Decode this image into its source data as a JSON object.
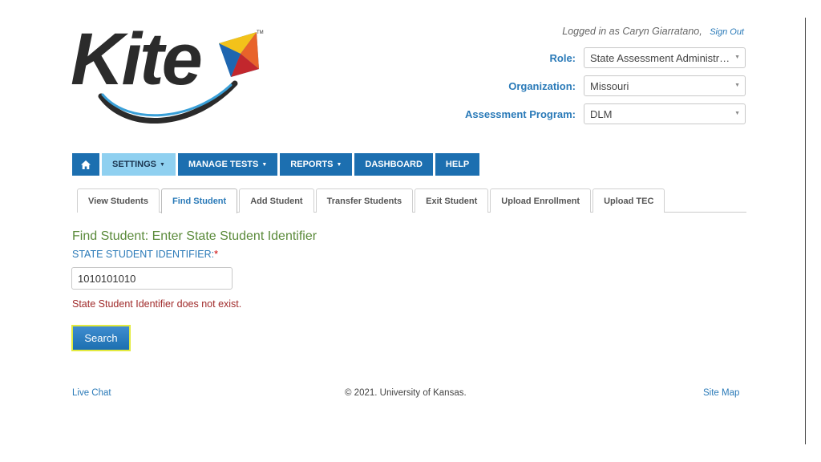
{
  "logo": {
    "text": "Kite",
    "trademark": "TM"
  },
  "header": {
    "logged_in_text": "Logged in as Caryn Giarratano,",
    "sign_out": "Sign Out",
    "role": {
      "label": "Role:",
      "value": "State Assessment Administra..."
    },
    "organization": {
      "label": "Organization:",
      "value": "Missouri"
    },
    "assessment_program": {
      "label": "Assessment Program:",
      "value": "DLM"
    }
  },
  "nav": {
    "home_icon": "home-icon",
    "items": [
      {
        "label": "SETTINGS",
        "dropdown": true,
        "active": true
      },
      {
        "label": "MANAGE TESTS",
        "dropdown": true
      },
      {
        "label": "REPORTS",
        "dropdown": true
      },
      {
        "label": "DASHBOARD"
      },
      {
        "label": "HELP"
      }
    ]
  },
  "tabs": [
    {
      "label": "View Students"
    },
    {
      "label": "Find Student",
      "active": true
    },
    {
      "label": "Add Student"
    },
    {
      "label": "Transfer Students"
    },
    {
      "label": "Exit Student"
    },
    {
      "label": "Upload Enrollment"
    },
    {
      "label": "Upload TEC"
    }
  ],
  "main": {
    "heading": "Find Student: Enter State Student Identifier",
    "field_label": "STATE STUDENT IDENTIFIER:",
    "required_mark": "*",
    "input_value": "1010101010",
    "error": "State Student Identifier does not exist.",
    "search_button": "Search"
  },
  "footer": {
    "live_chat": "Live Chat",
    "copyright": "© 2021. University of Kansas.",
    "site_map": "Site Map"
  },
  "colors": {
    "nav_blue": "#1c6fb0",
    "nav_active": "#8fd0f0",
    "link_blue": "#2a7ab8",
    "heading_green": "#5a8a3a",
    "error_red": "#a02a2a",
    "button_highlight": "#e3ea3e"
  }
}
